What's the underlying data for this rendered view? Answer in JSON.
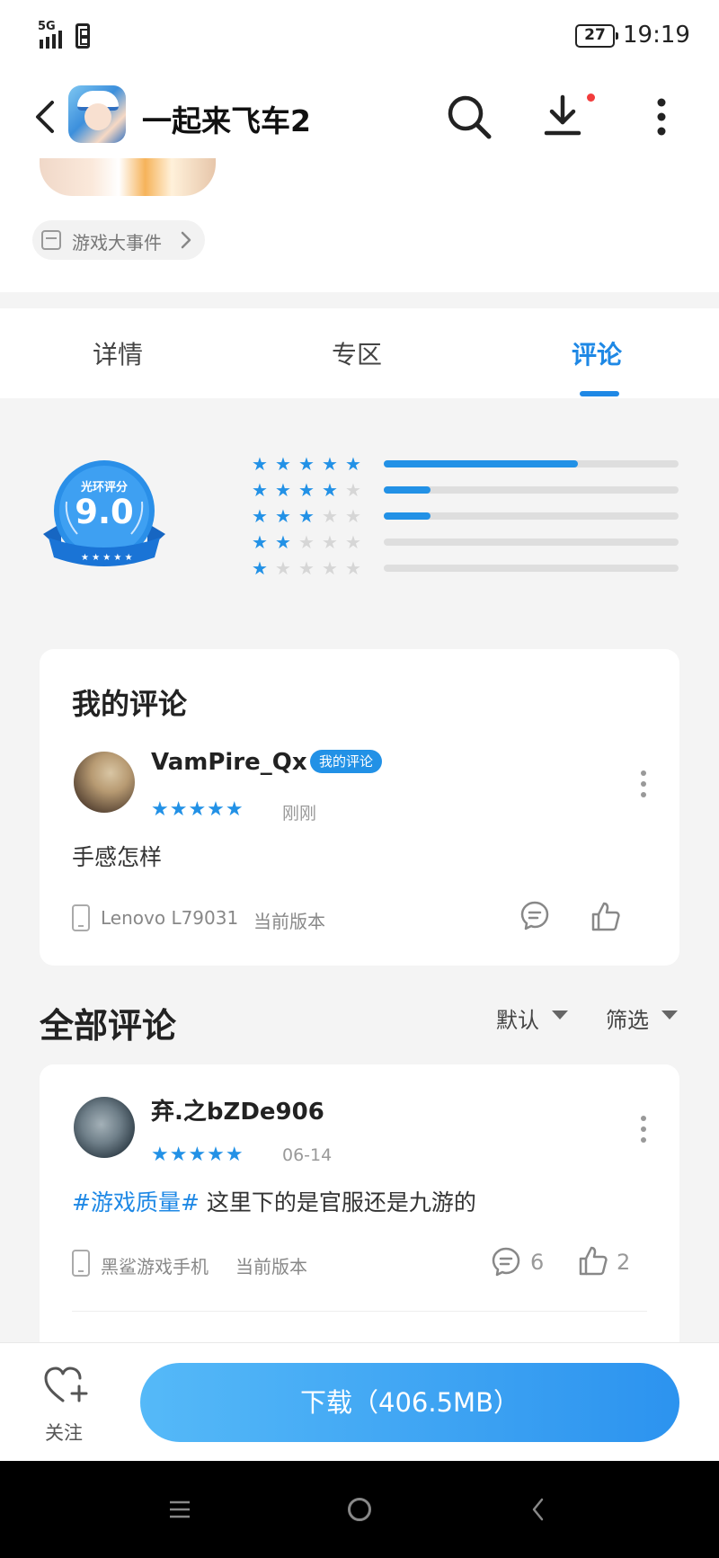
{
  "status_bar": {
    "network": "5G",
    "battery": "27",
    "time": "19:19"
  },
  "header": {
    "app_title": "一起来飞车2"
  },
  "event": {
    "label": "游戏大事件"
  },
  "tabs": [
    {
      "label": "详情",
      "active": false
    },
    {
      "label": "专区",
      "active": false
    },
    {
      "label": "评论",
      "active": true
    }
  ],
  "rating": {
    "badge_title": "光环评分",
    "score": "9.0",
    "distribution": [
      {
        "stars": 5,
        "fraction": 0.66
      },
      {
        "stars": 4,
        "fraction": 0.16
      },
      {
        "stars": 3,
        "fraction": 0.16
      },
      {
        "stars": 2,
        "fraction": 0.0
      },
      {
        "stars": 1,
        "fraction": 0.0
      }
    ]
  },
  "my_review": {
    "section_title": "我的评论",
    "username": "VamPire_Qx",
    "tag": "我的评论",
    "stars": 5,
    "time": "刚刚",
    "text": "手感怎样",
    "device": "Lenovo L79031",
    "version": "当前版本"
  },
  "all_reviews": {
    "section_title": "全部评论",
    "sort_label": "默认",
    "filter_label": "筛选",
    "items": [
      {
        "username": "弃.之bZDe906",
        "stars": 5,
        "time": "06-14",
        "hashtag": "#游戏质量#",
        "text": "这里下的是官服还是九游的",
        "device": "黑鲨游戏手机",
        "version": "当前版本",
        "reply_count": "6",
        "like_count": "2"
      }
    ]
  },
  "bottom_bar": {
    "follow_label": "关注",
    "download_label": "下载（406.5MB）"
  },
  "colors": {
    "accent": "#2291e6",
    "tab_active": "#1e88e5",
    "notify_dot": "#f23c3c"
  }
}
